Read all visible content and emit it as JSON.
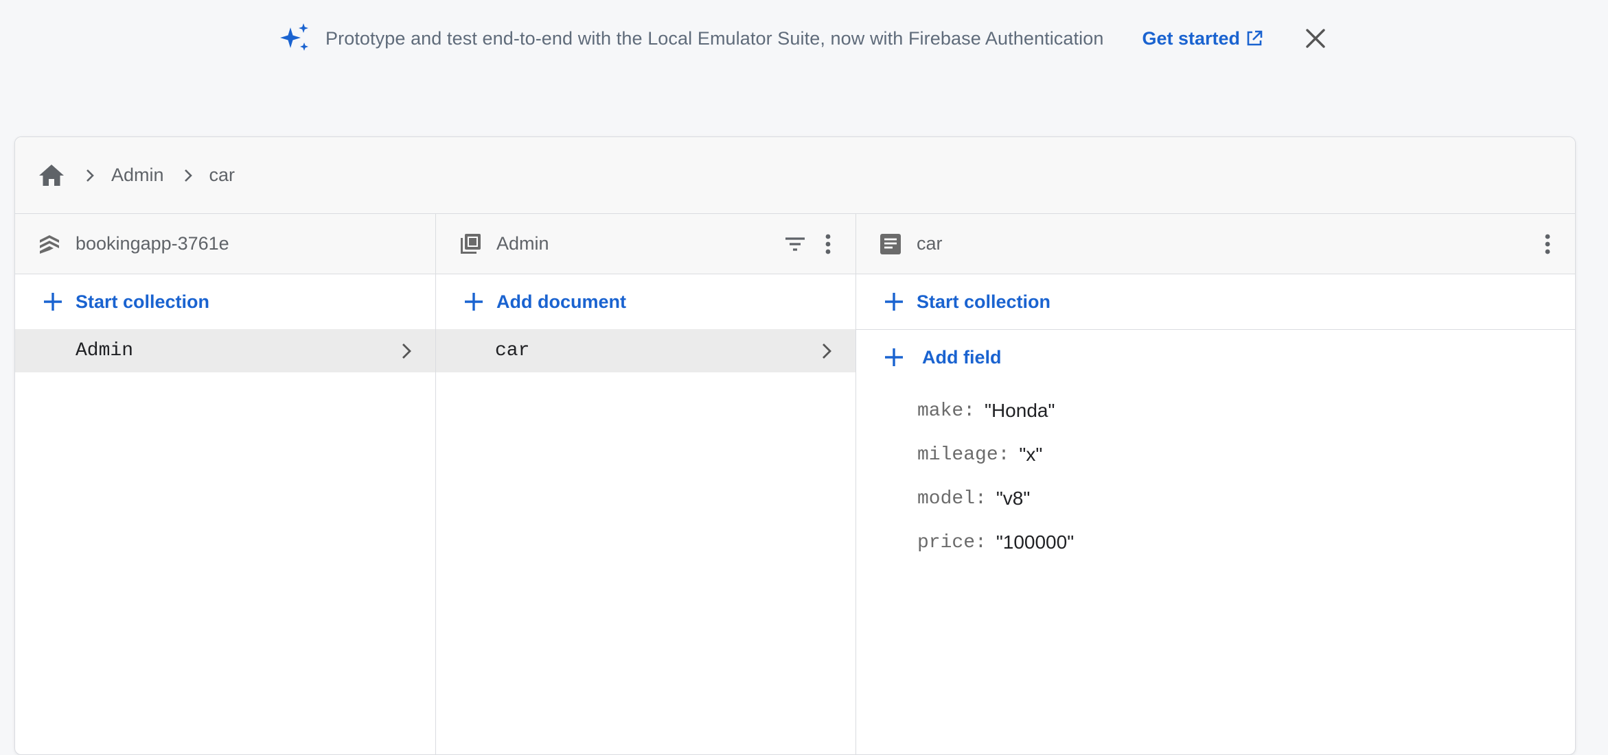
{
  "banner": {
    "icon": "sparkle-icon",
    "text": "Prototype and test end-to-end with the Local Emulator Suite, now with Firebase Authentication",
    "link_label": "Get started",
    "link_icon": "external-link-icon",
    "close_icon": "close-icon"
  },
  "breadcrumb": {
    "home_icon": "home-icon",
    "items": [
      "Admin",
      "car"
    ]
  },
  "columns": {
    "project": {
      "title": "bookingapp-3761e",
      "icon": "firestore-icon",
      "action_label": "Start collection",
      "items": [
        "Admin"
      ]
    },
    "collection": {
      "title": "Admin",
      "icon": "collection-icon",
      "action_label": "Add document",
      "items": [
        "car"
      ]
    },
    "document": {
      "title": "car",
      "icon": "document-icon",
      "action_label": "Start collection",
      "add_field_label": "Add field",
      "fields": [
        {
          "key": "make:",
          "value": "\"Honda\""
        },
        {
          "key": "mileage:",
          "value": "\"x\""
        },
        {
          "key": "model:",
          "value": "\"v8\""
        },
        {
          "key": "price:",
          "value": "\"100000\""
        }
      ]
    }
  },
  "colors": {
    "accent": "#1a63d0",
    "muted_text": "#5f6368",
    "selected_row": "#ebebeb",
    "page_bg": "#f6f7f9"
  }
}
